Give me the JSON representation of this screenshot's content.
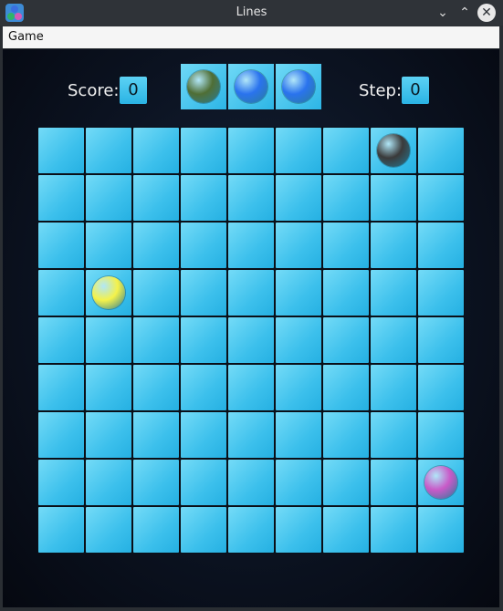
{
  "window": {
    "title": "Lines"
  },
  "menu": {
    "items": [
      "Game"
    ]
  },
  "score": {
    "label": "Score:",
    "value": "0"
  },
  "step": {
    "label": "Step:",
    "value": "0"
  },
  "next_balls": [
    "dark-green",
    "blue",
    "blue"
  ],
  "board": {
    "rows": 9,
    "cols": 9,
    "balls": [
      {
        "row": 0,
        "col": 7,
        "color": "black"
      },
      {
        "row": 3,
        "col": 1,
        "color": "yellow"
      },
      {
        "row": 7,
        "col": 8,
        "color": "magenta"
      }
    ]
  },
  "colors": {
    "dark-green": "#4f6e35",
    "blue": "#2a73ee",
    "black": "#3a3a3a",
    "yellow": "#f5f24a",
    "magenta": "#c95ac8",
    "cell": "#3cc0ec"
  }
}
